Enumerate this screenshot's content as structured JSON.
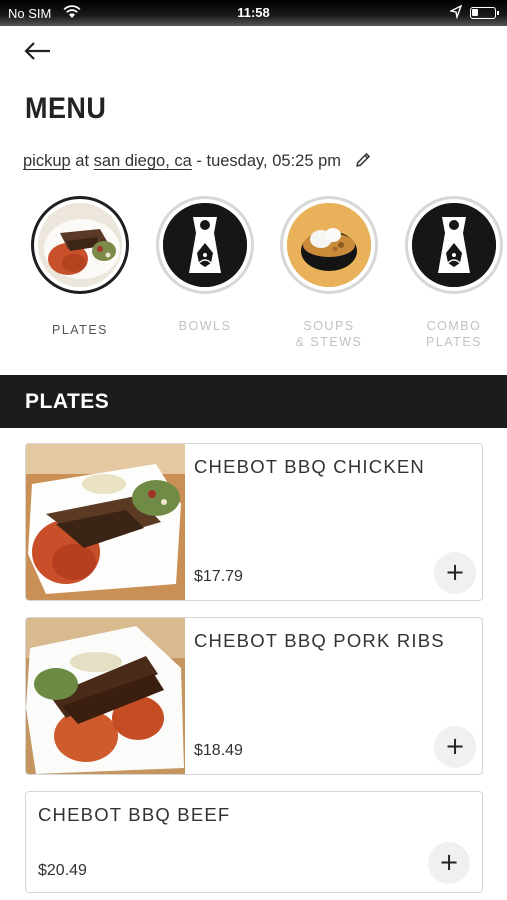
{
  "status_bar": {
    "carrier": "No SIM",
    "time": "11:58"
  },
  "page": {
    "title": "MENU"
  },
  "order": {
    "mode": "pickup",
    "at": "at",
    "location": "san diego, ca",
    "when": "- tuesday, 05:25 pm"
  },
  "categories": [
    {
      "label": "PLATES",
      "active": true,
      "icon": "plate-photo"
    },
    {
      "label": "BOWLS",
      "active": false,
      "icon": "logo-icon"
    },
    {
      "label_line1": "SOUPS",
      "label_line2": "& STEWS",
      "active": false,
      "icon": "soup-photo"
    },
    {
      "label_line1": "COMBO",
      "label_line2": "PLATES",
      "active": false,
      "icon": "logo-icon"
    }
  ],
  "section": {
    "title": "PLATES"
  },
  "items": [
    {
      "name": "CHEBOT BBQ CHICKEN",
      "price": "$17.79",
      "has_photo": true
    },
    {
      "name": "CHEBOT BBQ PORK RIBS",
      "price": "$18.49",
      "has_photo": true
    },
    {
      "name": "CHEBOT BBQ BEEF",
      "price": "$20.49",
      "has_photo": false
    }
  ],
  "add_symbol": "+",
  "colors": {
    "header_bar": "#1c1c1c",
    "active_ring": "#1e1e1e",
    "inactive_ring": "#d7d7d7",
    "soup_bg": "#e8b15a"
  }
}
